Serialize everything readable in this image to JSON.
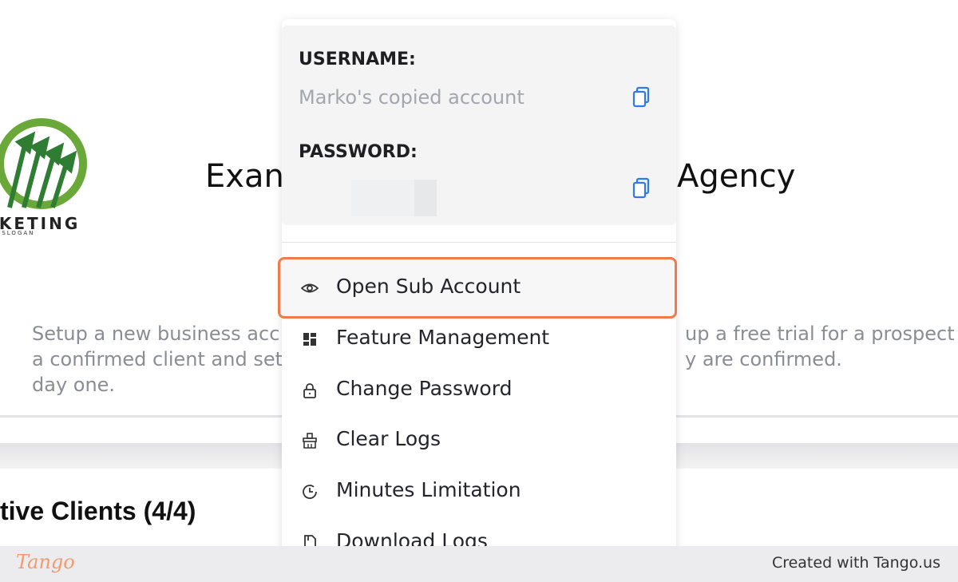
{
  "background": {
    "agency_title_left": "Exan",
    "agency_title_right": "Agency",
    "logo_word": "ARKETING",
    "logo_slogan": "MPANY SLOGAN",
    "description_left": "Setup a new business acc\na confirmed client and set\nday one.",
    "description_right": "up a free trial for a prospect\ny are confirmed.",
    "clients_heading": "tive Clients (4/4)"
  },
  "dropdown": {
    "username_label": "USERNAME:",
    "username_value": "Marko's copied account",
    "password_label": "PASSWORD:",
    "copy_icon": "copy-icon",
    "menu_items": [
      {
        "label": "Open Sub Account",
        "icon": "eye-icon"
      },
      {
        "label": "Feature Management",
        "icon": "grid-icon"
      },
      {
        "label": "Change Password",
        "icon": "lock-icon"
      },
      {
        "label": "Clear Logs",
        "icon": "broom-icon"
      },
      {
        "label": "Minutes Limitation",
        "icon": "clock-icon"
      },
      {
        "label": "Download Logs",
        "icon": "file-icon"
      }
    ]
  },
  "footer": {
    "brand": "Tango",
    "credit": "Created with Tango.us"
  },
  "colors": {
    "highlight_border": "#f27a4a",
    "copy_icon": "#2f7be5",
    "tango_brand": "#f29b6f"
  }
}
